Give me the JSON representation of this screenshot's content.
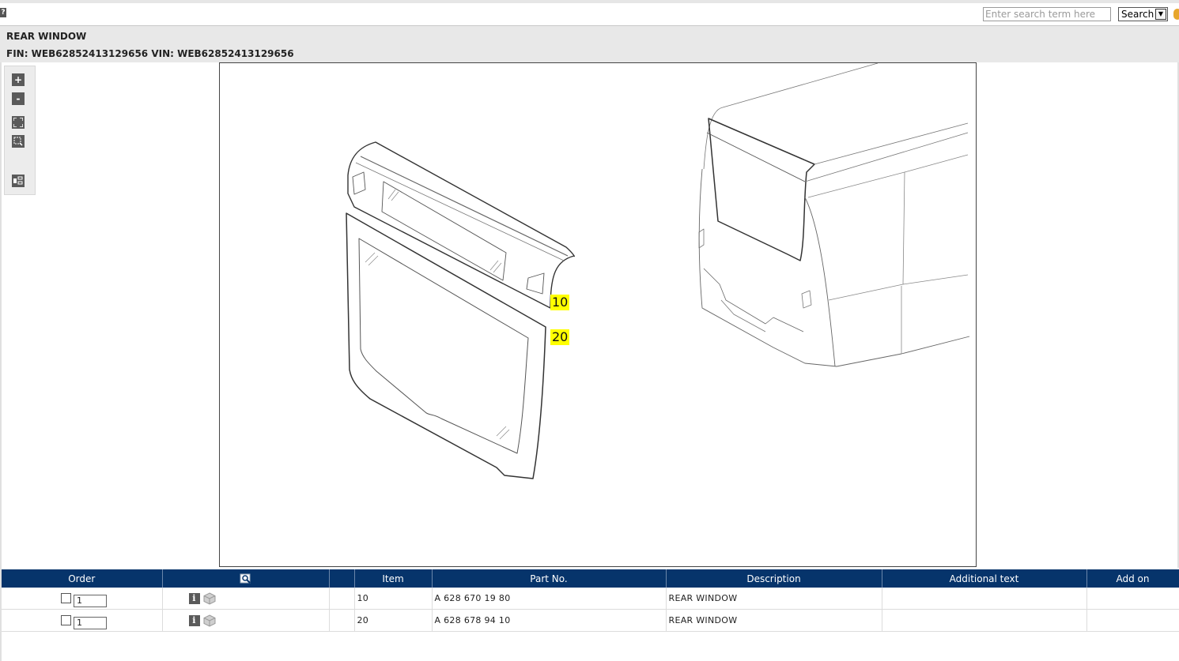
{
  "toolbar": {
    "help_label": "?",
    "search_placeholder": "Enter search term here",
    "search_select_value": "Search"
  },
  "header": {
    "title": "REAR WINDOW",
    "fin_line": "FIN: WEB62852413129656 VIN: WEB62852413129656"
  },
  "zoom_panel": {
    "zoom_in_label": "+",
    "zoom_out_label": "-"
  },
  "drawing": {
    "callouts": [
      "10",
      "20"
    ]
  },
  "table": {
    "headers": {
      "order": "Order",
      "item": "Item",
      "part_no": "Part No.",
      "description": "Description",
      "additional_text": "Additional text",
      "add_on": "Add on"
    },
    "rows": [
      {
        "qty": "1",
        "item": "10",
        "part_no": "A 628 670 19 80",
        "description": "REAR WINDOW",
        "additional_text": "",
        "add_on": ""
      },
      {
        "qty": "1",
        "item": "20",
        "part_no": "A 628 678 94 10",
        "description": "REAR WINDOW",
        "additional_text": "",
        "add_on": ""
      }
    ]
  },
  "colors": {
    "table_header_bg": "#06346b",
    "callout_bg": "#ffff00",
    "header_bg": "#e8e8e8"
  }
}
